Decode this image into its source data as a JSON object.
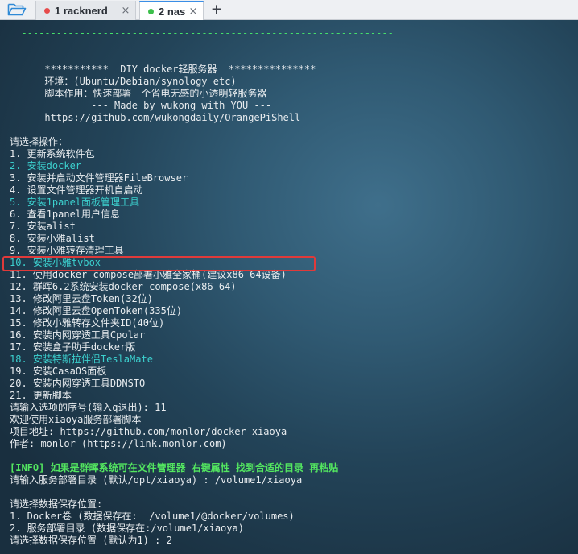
{
  "tabs": [
    {
      "label": "1 racknerd",
      "dot_color": "#e64b4b",
      "close": "×",
      "active": false
    },
    {
      "label": "2 nas",
      "dot_color": "#3cbf4a",
      "close": "×",
      "active": true
    }
  ],
  "new_tab_label": "+",
  "icons": {
    "open": "folder-open-icon",
    "close": "close-icon",
    "add": "plus-icon"
  },
  "terminal": {
    "lines": [
      {
        "text": "  ----------------------------------------------------------------",
        "color": "green"
      },
      {
        "text": "",
        "color": "default"
      },
      {
        "text": "",
        "color": "default"
      },
      {
        "text": "      ***********  DIY docker轻服务器  ***************",
        "color": "default"
      },
      {
        "text": "      环境：(Ubuntu/Debian/synology etc)",
        "color": "default"
      },
      {
        "text": "      脚本作用：快速部署一个省电无感的小透明轻服务器",
        "color": "default"
      },
      {
        "text": "              --- Made by wukong with YOU ---",
        "color": "default"
      },
      {
        "text": "      https://github.com/wukongdaily/OrangePiShell",
        "color": "default"
      },
      {
        "text": "  ----------------------------------------------------------------",
        "color": "green"
      },
      {
        "text": "请选择操作：",
        "color": "default"
      },
      {
        "text": "1. 更新系统软件包",
        "color": "default"
      },
      {
        "text": "2. 安装docker",
        "color": "cyan"
      },
      {
        "text": "3. 安装并启动文件管理器FileBrowser",
        "color": "default"
      },
      {
        "text": "4. 设置文件管理器开机自启动",
        "color": "default"
      },
      {
        "text": "5. 安装1panel面板管理工具",
        "color": "cyan"
      },
      {
        "text": "6. 查看1panel用户信息",
        "color": "default"
      },
      {
        "text": "7. 安装alist",
        "color": "default"
      },
      {
        "text": "8. 安装小雅alist",
        "color": "default"
      },
      {
        "text": "9. 安装小雅转存清理工具",
        "color": "default"
      },
      {
        "text": "10. 安装小雅tvbox",
        "color": "cyan"
      },
      {
        "text": "11. 使用docker-compose部署小雅全家桶(建议x86-64设备)",
        "color": "default"
      },
      {
        "text": "12. 群晖6.2系统安装docker-compose(x86-64)",
        "color": "default"
      },
      {
        "text": "13. 修改阿里云盘Token(32位)",
        "color": "default"
      },
      {
        "text": "14. 修改阿里云盘OpenToken(335位)",
        "color": "default"
      },
      {
        "text": "15. 修改小雅转存文件夹ID(40位)",
        "color": "default"
      },
      {
        "text": "16. 安装内网穿透工具Cpolar",
        "color": "default"
      },
      {
        "text": "17. 安装盒子助手docker版",
        "color": "default"
      },
      {
        "text": "18. 安装特斯拉伴侣TeslaMate",
        "color": "cyan"
      },
      {
        "text": "19. 安装CasaOS面板",
        "color": "default"
      },
      {
        "text": "20. 安装内网穿透工具DDNSTO",
        "color": "default"
      },
      {
        "text": "21. 更新脚本",
        "color": "default"
      },
      {
        "text": "请输入选项的序号(输入q退出): 11",
        "color": "default"
      },
      {
        "text": "欢迎使用xiaoya服务部署脚本",
        "color": "default"
      },
      {
        "text": "项目地址: https://github.com/monlor/docker-xiaoya",
        "color": "default"
      },
      {
        "text": "作者: monlor (https://link.monlor.com)",
        "color": "default"
      },
      {
        "text": "",
        "color": "default"
      },
      {
        "text": "[INFO] 如果是群晖系统可在文件管理器 右键属性 找到合适的目录 再粘贴",
        "color": "info"
      },
      {
        "text": "请输入服务部署目录 (默认/opt/xiaoya) : /volume1/xiaoya",
        "color": "default"
      },
      {
        "text": "",
        "color": "default"
      },
      {
        "text": "请选择数据保存位置:",
        "color": "default"
      },
      {
        "text": "1. Docker卷 (数据保存在:  /volume1/@docker/volumes)",
        "color": "default"
      },
      {
        "text": "2. 服务部署目录 (数据保存在:/volume1/xiaoya)",
        "color": "default"
      },
      {
        "text": "请选择数据保存位置 (默认为1) : 2",
        "color": "default"
      }
    ],
    "highlighted_line": 20,
    "highlight_color": "#e03a3a"
  }
}
